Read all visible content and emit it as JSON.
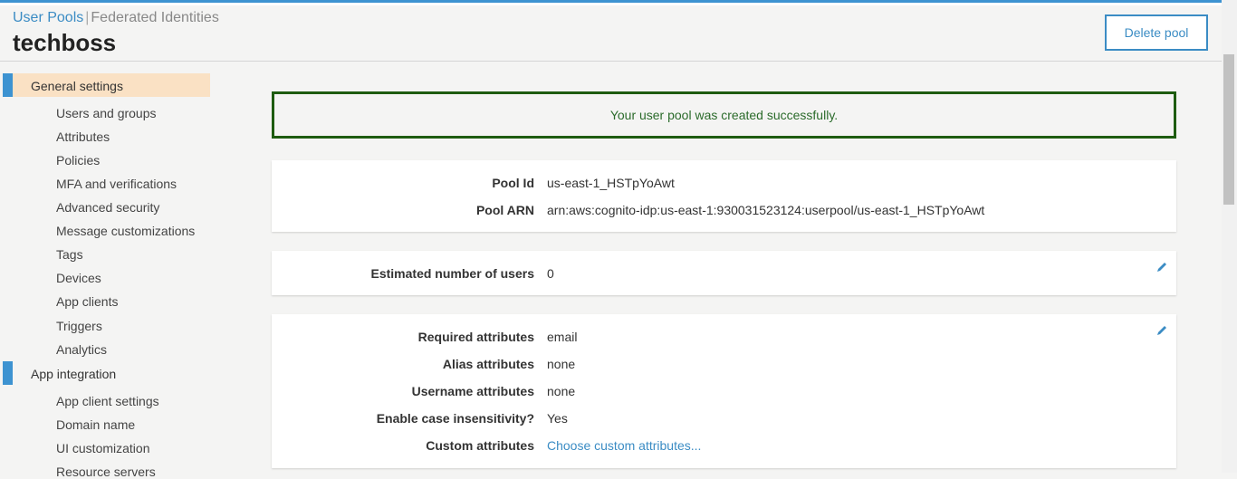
{
  "header": {
    "breadcrumb": {
      "user_pools": "User Pools",
      "separator": "|",
      "federated": "Federated Identities"
    },
    "title": "techboss",
    "delete_button": "Delete pool"
  },
  "sidebar": {
    "sections": [
      {
        "label": "General settings",
        "active": true,
        "items": [
          "Users and groups",
          "Attributes",
          "Policies",
          "MFA and verifications",
          "Advanced security",
          "Message customizations",
          "Tags",
          "Devices",
          "App clients",
          "Triggers",
          "Analytics"
        ]
      },
      {
        "label": "App integration",
        "active": false,
        "items": [
          "App client settings",
          "Domain name",
          "UI customization",
          "Resource servers"
        ]
      }
    ]
  },
  "success_message": "Your user pool was created successfully.",
  "pool_info": {
    "pool_id_label": "Pool Id",
    "pool_id": "us-east-1_HSTpYoAwt",
    "pool_arn_label": "Pool ARN",
    "pool_arn": "arn:aws:cognito-idp:us-east-1:930031523124:userpool/us-east-1_HSTpYoAwt"
  },
  "users": {
    "label": "Estimated number of users",
    "value": "0"
  },
  "attributes": {
    "required_label": "Required attributes",
    "required": "email",
    "alias_label": "Alias attributes",
    "alias": "none",
    "username_label": "Username attributes",
    "username": "none",
    "case_label": "Enable case insensitivity?",
    "case": "Yes",
    "custom_label": "Custom attributes",
    "custom": "Choose custom attributes..."
  },
  "colors": {
    "accent": "#3d93d1",
    "link": "#3b8cc4",
    "active_bg": "#fae1c4",
    "success_border": "#1e5c10"
  }
}
